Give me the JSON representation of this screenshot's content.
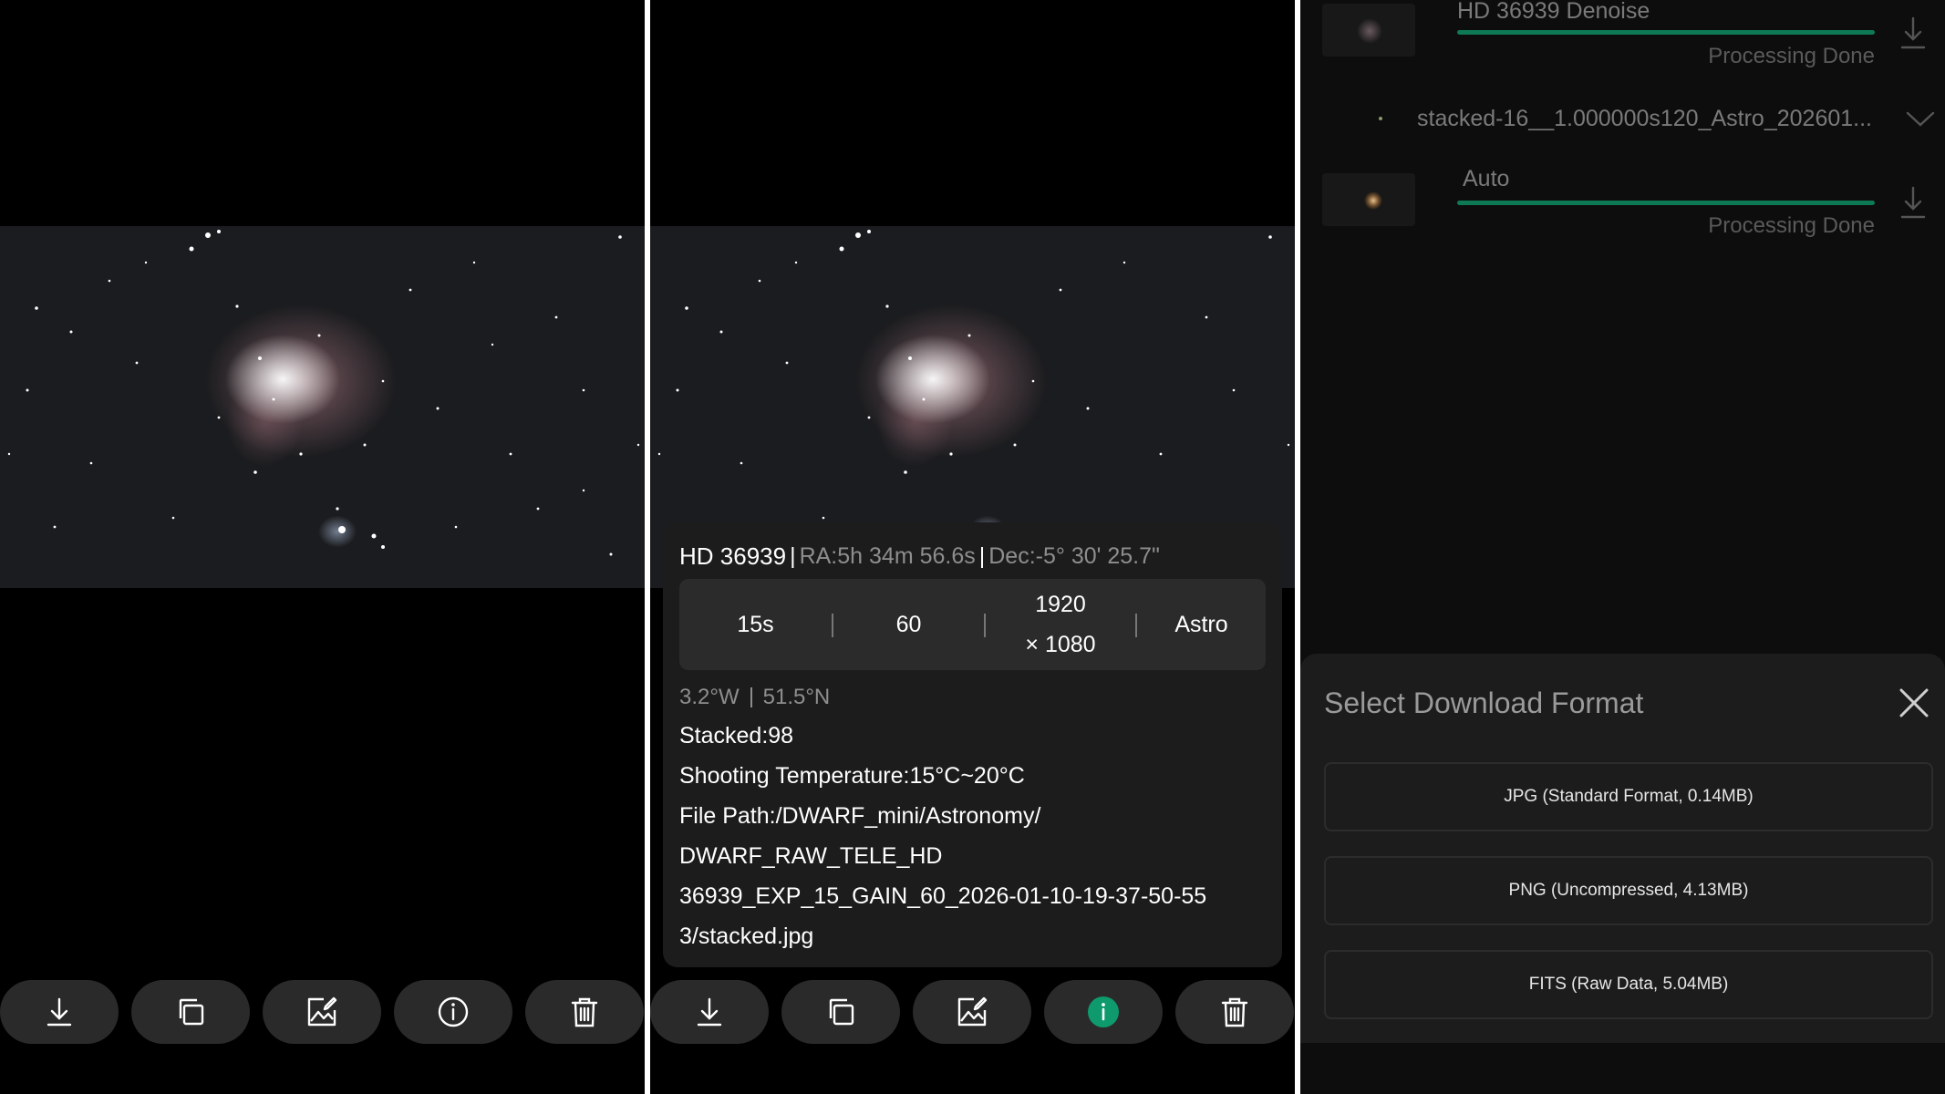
{
  "toolbar": {
    "buttons": [
      "download",
      "copy",
      "edit-image",
      "info",
      "delete"
    ]
  },
  "info_popup": {
    "target_name": "HD 36939",
    "ra": "RA:5h 34m 56.6s",
    "dec": "Dec:-5° 30' 25.7\"",
    "separator": "|",
    "stats": {
      "exposure": "15s",
      "gain": "60",
      "resolution_line1": "1920",
      "resolution_line2": "× 1080",
      "mode": "Astro"
    },
    "longitude": "3.2°W",
    "latitude": "51.5°N",
    "stacked": "Stacked:98",
    "temperature": "Shooting Temperature:15°C~20°C",
    "path_line1": "File Path:/DWARF_mini/Astronomy/",
    "path_line2": "DWARF_RAW_TELE_HD",
    "path_line3": "36939_EXP_15_GAIN_60_2026-01-10-19-37-50-55",
    "path_line4": "3/stacked.jpg"
  },
  "downloads": {
    "items": [
      {
        "title": "HD 36939 Denoise",
        "status": "Processing Done",
        "progress": 1.0
      },
      {
        "title": "stacked-16__1.000000s120_Astro_202601..."
      },
      {
        "title": "Auto",
        "status": "Processing Done",
        "progress": 1.0
      }
    ]
  },
  "format_sheet": {
    "title": "Select Download Format",
    "options": [
      "JPG (Standard Format, 0.14MB)",
      "PNG (Uncompressed, 4.13MB)",
      "FITS (Raw Data, 5.04MB)"
    ]
  },
  "colors": {
    "accent": "#0e9a6c",
    "progress": "#0e7a55",
    "toolbar_button": "#2a2a2a",
    "panel_background": "#1c1c1c"
  }
}
